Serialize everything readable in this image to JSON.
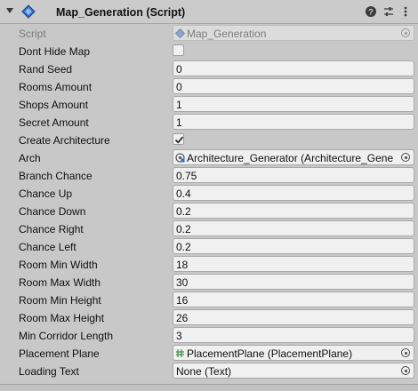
{
  "component": {
    "title": "Map_Generation (Script)",
    "enabled": true
  },
  "fields": {
    "script": {
      "label": "Script",
      "value": "Map_Generation"
    },
    "dont_hide_map": {
      "label": "Dont Hide Map",
      "checked": false
    },
    "rand_seed": {
      "label": "Rand Seed",
      "value": "0"
    },
    "rooms_amount": {
      "label": "Rooms Amount",
      "value": "0"
    },
    "shops_amount": {
      "label": "Shops Amount",
      "value": "1"
    },
    "secret_amount": {
      "label": "Secret Amount",
      "value": "1"
    },
    "create_architecture": {
      "label": "Create Architecture",
      "checked": true
    },
    "arch": {
      "label": "Arch",
      "value": "Architecture_Generator (Architecture_Gene"
    },
    "branch_chance": {
      "label": "Branch Chance",
      "value": "0.75"
    },
    "chance_up": {
      "label": "Chance Up",
      "value": "0.4"
    },
    "chance_down": {
      "label": "Chance Down",
      "value": "0.2"
    },
    "chance_right": {
      "label": "Chance Right",
      "value": "0.2"
    },
    "chance_left": {
      "label": "Chance Left",
      "value": "0.2"
    },
    "room_min_width": {
      "label": "Room Min Width",
      "value": "18"
    },
    "room_max_width": {
      "label": "Room Max Width",
      "value": "30"
    },
    "room_min_height": {
      "label": "Room Min Height",
      "value": "16"
    },
    "room_max_height": {
      "label": "Room Max Height",
      "value": "26"
    },
    "min_corridor_length": {
      "label": "Min Corridor Length",
      "value": "3"
    },
    "placement_plane": {
      "label": "Placement Plane",
      "value": "PlacementPlane (PlacementPlane)"
    },
    "loading_text": {
      "label": "Loading Text",
      "value": "None (Text)"
    }
  },
  "icons": {
    "header": [
      "foldout-arrow-icon",
      "script-icon",
      "help-icon",
      "presets-icon",
      "context-menu-icon"
    ],
    "object_pickers": "object-picker-icon"
  },
  "colors": {
    "panel_bg": "#c8c8c8",
    "field_bg": "#f0f0f0",
    "script_icon": "#2f6fd1"
  }
}
